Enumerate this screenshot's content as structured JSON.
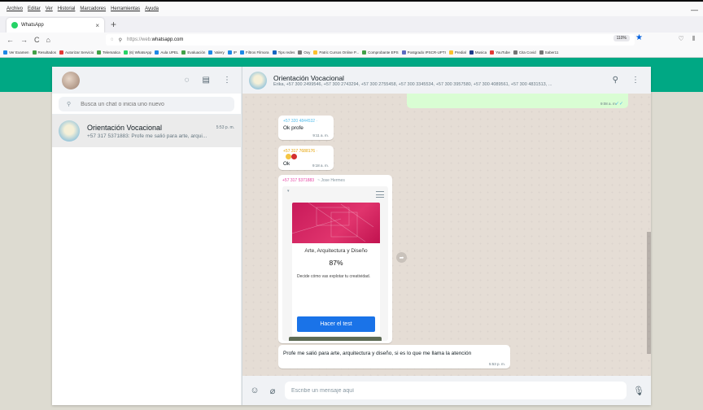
{
  "browser": {
    "menu": [
      "Archivo",
      "Editar",
      "Ver",
      "Historial",
      "Marcadores",
      "Herramientas",
      "Ayuda"
    ],
    "tab_title": "WhatsApp",
    "tab_close": "×",
    "new_tab": "+",
    "url_prefix": "https://web.",
    "url_domain": "whatsapp.com",
    "zoom": "110%",
    "bookmarks": [
      {
        "label": "Ver Examen",
        "color": "#1e88e5"
      },
      {
        "label": "Resultados",
        "color": "#43a047"
      },
      {
        "label": "Autorizar Servicio",
        "color": "#e53935"
      },
      {
        "label": "Telematica",
        "color": "#43a047"
      },
      {
        "label": "(6) WhatsApp",
        "color": "#25d366"
      },
      {
        "label": "Aula UPEL",
        "color": "#1e88e5"
      },
      {
        "label": "Evaluación",
        "color": "#43a047"
      },
      {
        "label": "Valery",
        "color": "#1e88e5"
      },
      {
        "label": "IP",
        "color": "#1e88e5"
      },
      {
        "label": "Filtros Filmora",
        "color": "#1e88e5"
      },
      {
        "label": "Tips redes",
        "color": "#1565c0"
      },
      {
        "label": "Oxy",
        "color": "#757575"
      },
      {
        "label": "Patric Cursos Online P...",
        "color": "#fbc02d"
      },
      {
        "label": "Comprobante EPS",
        "color": "#43a047"
      },
      {
        "label": "Postgrado IPSCR-UPTI",
        "color": "#5c6bc0"
      },
      {
        "label": "Predial",
        "color": "#fbc02d"
      },
      {
        "label": "Musica",
        "color": "#1e3a8a"
      },
      {
        "label": "YouTube",
        "color": "#e53935"
      },
      {
        "label": "Cita Covid",
        "color": "#757575"
      },
      {
        "label": "Saber11",
        "color": "#757575"
      }
    ]
  },
  "sidebar": {
    "search_placeholder": "Busca un chat o inicia uno nuevo",
    "chats": [
      {
        "name": "Orientación Vocacional",
        "time": "5:53 p. m.",
        "last_message": "+57 317 5371883: Profe me salió para arte, arqui..."
      }
    ]
  },
  "conversation": {
    "title": "Orientación Vocacional",
    "members": "Erika, +57 300 2499546, +57 300 2743294, +57 300 2755458, +57 300 3345534, +57 300 3957580, +57 300 4089561, +57 300 4831513, ...",
    "outgoing_time": "9:08 a. m.",
    "messages": [
      {
        "sender": "+57 320 4844532",
        "sender_suffix": "· ",
        "text": "Ok profe",
        "time": "9:11 a. m."
      },
      {
        "sender": "+57 317 7688176",
        "sender_suffix": "· ",
        "text": "Ok",
        "time": "9:18 a. m."
      },
      {
        "sender": "+57 317 5371883",
        "sender_name": "~ Jose Hermes",
        "card": {
          "title": "Arte, Arquitectura y Diseño",
          "percent": "87%",
          "description": "Decide cómo vas explotar tu creatividad.",
          "button": "Hacer el test"
        }
      },
      {
        "text": "Profe me salió para arte, arquitectura y diseño, si es lo que me llama la atención",
        "time": "5:53 p. m."
      }
    ],
    "compose_placeholder": "Escribe un mensaje aquí"
  },
  "icons": {
    "left_header": [
      "status-icon",
      "new-chat-icon",
      "menu-icon"
    ],
    "right_header": [
      "search-icon",
      "menu-icon"
    ],
    "compose": [
      "emoji-icon",
      "attach-icon",
      "mic-icon"
    ]
  },
  "colors": {
    "accent_green": "#00a884",
    "outgoing_bubble": "#d9fdd3",
    "button_blue": "#1a73e8",
    "card_magenta": "#d1245f"
  }
}
